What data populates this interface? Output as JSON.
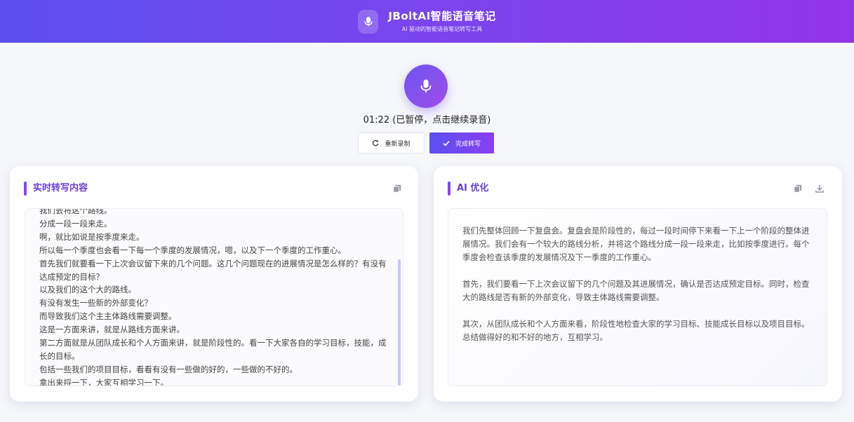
{
  "header": {
    "title": "JBoltAI智能语音笔记",
    "subtitle": "AI 驱动的智能语音笔记转写工具",
    "logo_icon": "microphone-icon"
  },
  "recorder": {
    "mic_icon": "microphone-icon",
    "status": "01:22 (已暂停，点击继续录音)",
    "rerecord_label": "重新录制",
    "rerecord_icon": "refresh-icon",
    "finish_label": "完成转写",
    "finish_icon": "check-icon"
  },
  "transcript_panel": {
    "title": "实时转写内容",
    "copy_icon": "copy-icon",
    "lines": [
      "我们会将这个路线。",
      "分成一段一段来走。",
      "啊，就比如说是按季度来走。",
      "所以每一个季度也会看一下每一个季度的发展情况，嗯，以及下一个季度的工作重心。",
      "首先我们就要看一下上次会议留下来的几个问题。这几个问题现在的进展情况是怎么样的？有没有",
      "达成预定的目标？",
      "以及我们的这个大的路线。",
      "有没有发生一些新的外部变化？",
      "而导致我们这个主主体路线需要调整。",
      "这是一方面来讲，就是从路线方面来讲。",
      "第二方面就是从团队成长和个人方面来讲，就是阶段性的。看一下大家各自的学习目标，技能，成",
      "长的目标。",
      "包括一些我们的项目目标，看看有没有一些做的好的，一些做的不好的。",
      "拿出来捋一下，大家互相学习一下。"
    ]
  },
  "ai_panel": {
    "title": "AI 优化",
    "copy_icon": "copy-icon",
    "download_icon": "download-icon",
    "paragraphs": [
      "我们先整体回顾一下复盘会。复盘会是阶段性的，每过一段时间停下来看一下上一个阶段的整体进展情况。我们会有一个较大的路线分析，并将这个路线分成一段一段来走，比如按季度进行。每个季度会检查该季度的发展情况及下一季度的工作重心。",
      "首先，我们要看一下上次会议留下的几个问题及其进展情况，确认是否达成预定目标。同时，检查大的路线是否有新的外部变化，导致主体路线需要调整。",
      "其次，从团队成长和个人方面来看，阶段性地检查大家的学习目标、技能成长目标以及项目目标。总结做得好的和不好的地方，互相学习。"
    ]
  },
  "colors": {
    "accent": "#6a3fd6",
    "header_gradient_start": "#5b4ff0",
    "header_gradient_end": "#9235e6"
  }
}
